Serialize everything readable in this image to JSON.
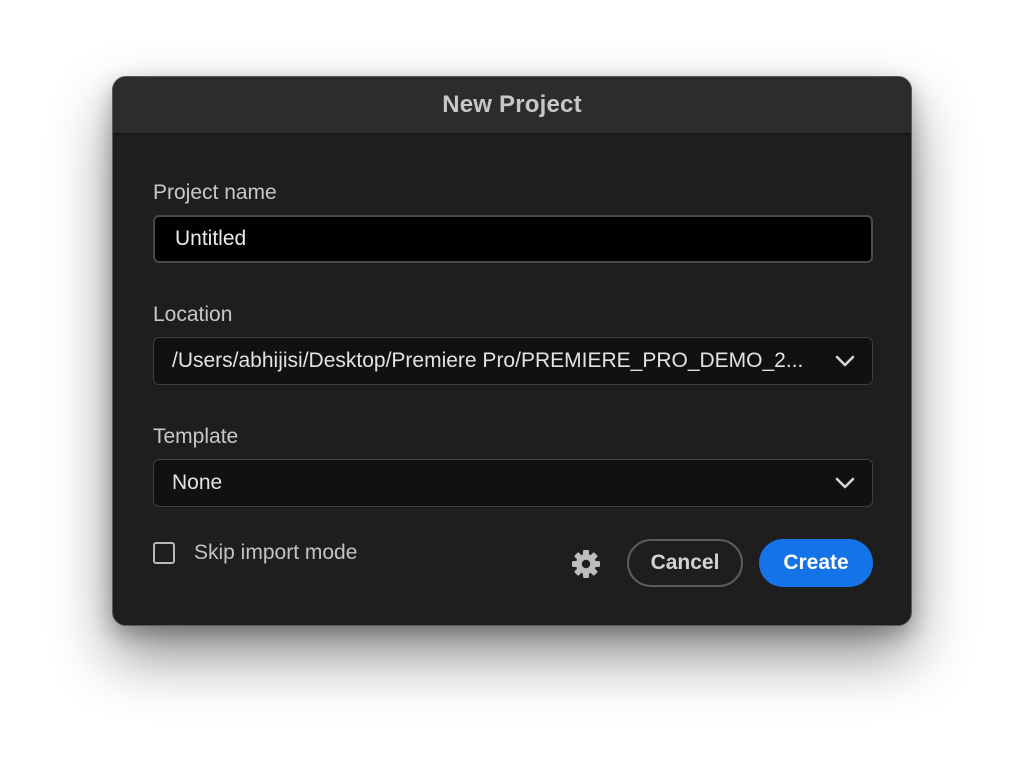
{
  "dialog": {
    "title": "New Project"
  },
  "project_name": {
    "label": "Project name",
    "value": "Untitled"
  },
  "location": {
    "label": "Location",
    "value": "/Users/abhijisi/Desktop/Premiere Pro/PREMIERE_PRO_DEMO_2...",
    "icon": "chevron-down-icon"
  },
  "template": {
    "label": "Template",
    "value": "None",
    "icon": "chevron-down-icon"
  },
  "skip_import": {
    "label": "Skip import mode",
    "checked": false
  },
  "settings": {
    "icon": "gear-icon"
  },
  "buttons": {
    "cancel_label": "Cancel",
    "create_label": "Create"
  },
  "colors": {
    "dialog_bg": "#1e1e1e",
    "titlebar_bg": "#2c2c2e",
    "accent": "#1473e6"
  }
}
